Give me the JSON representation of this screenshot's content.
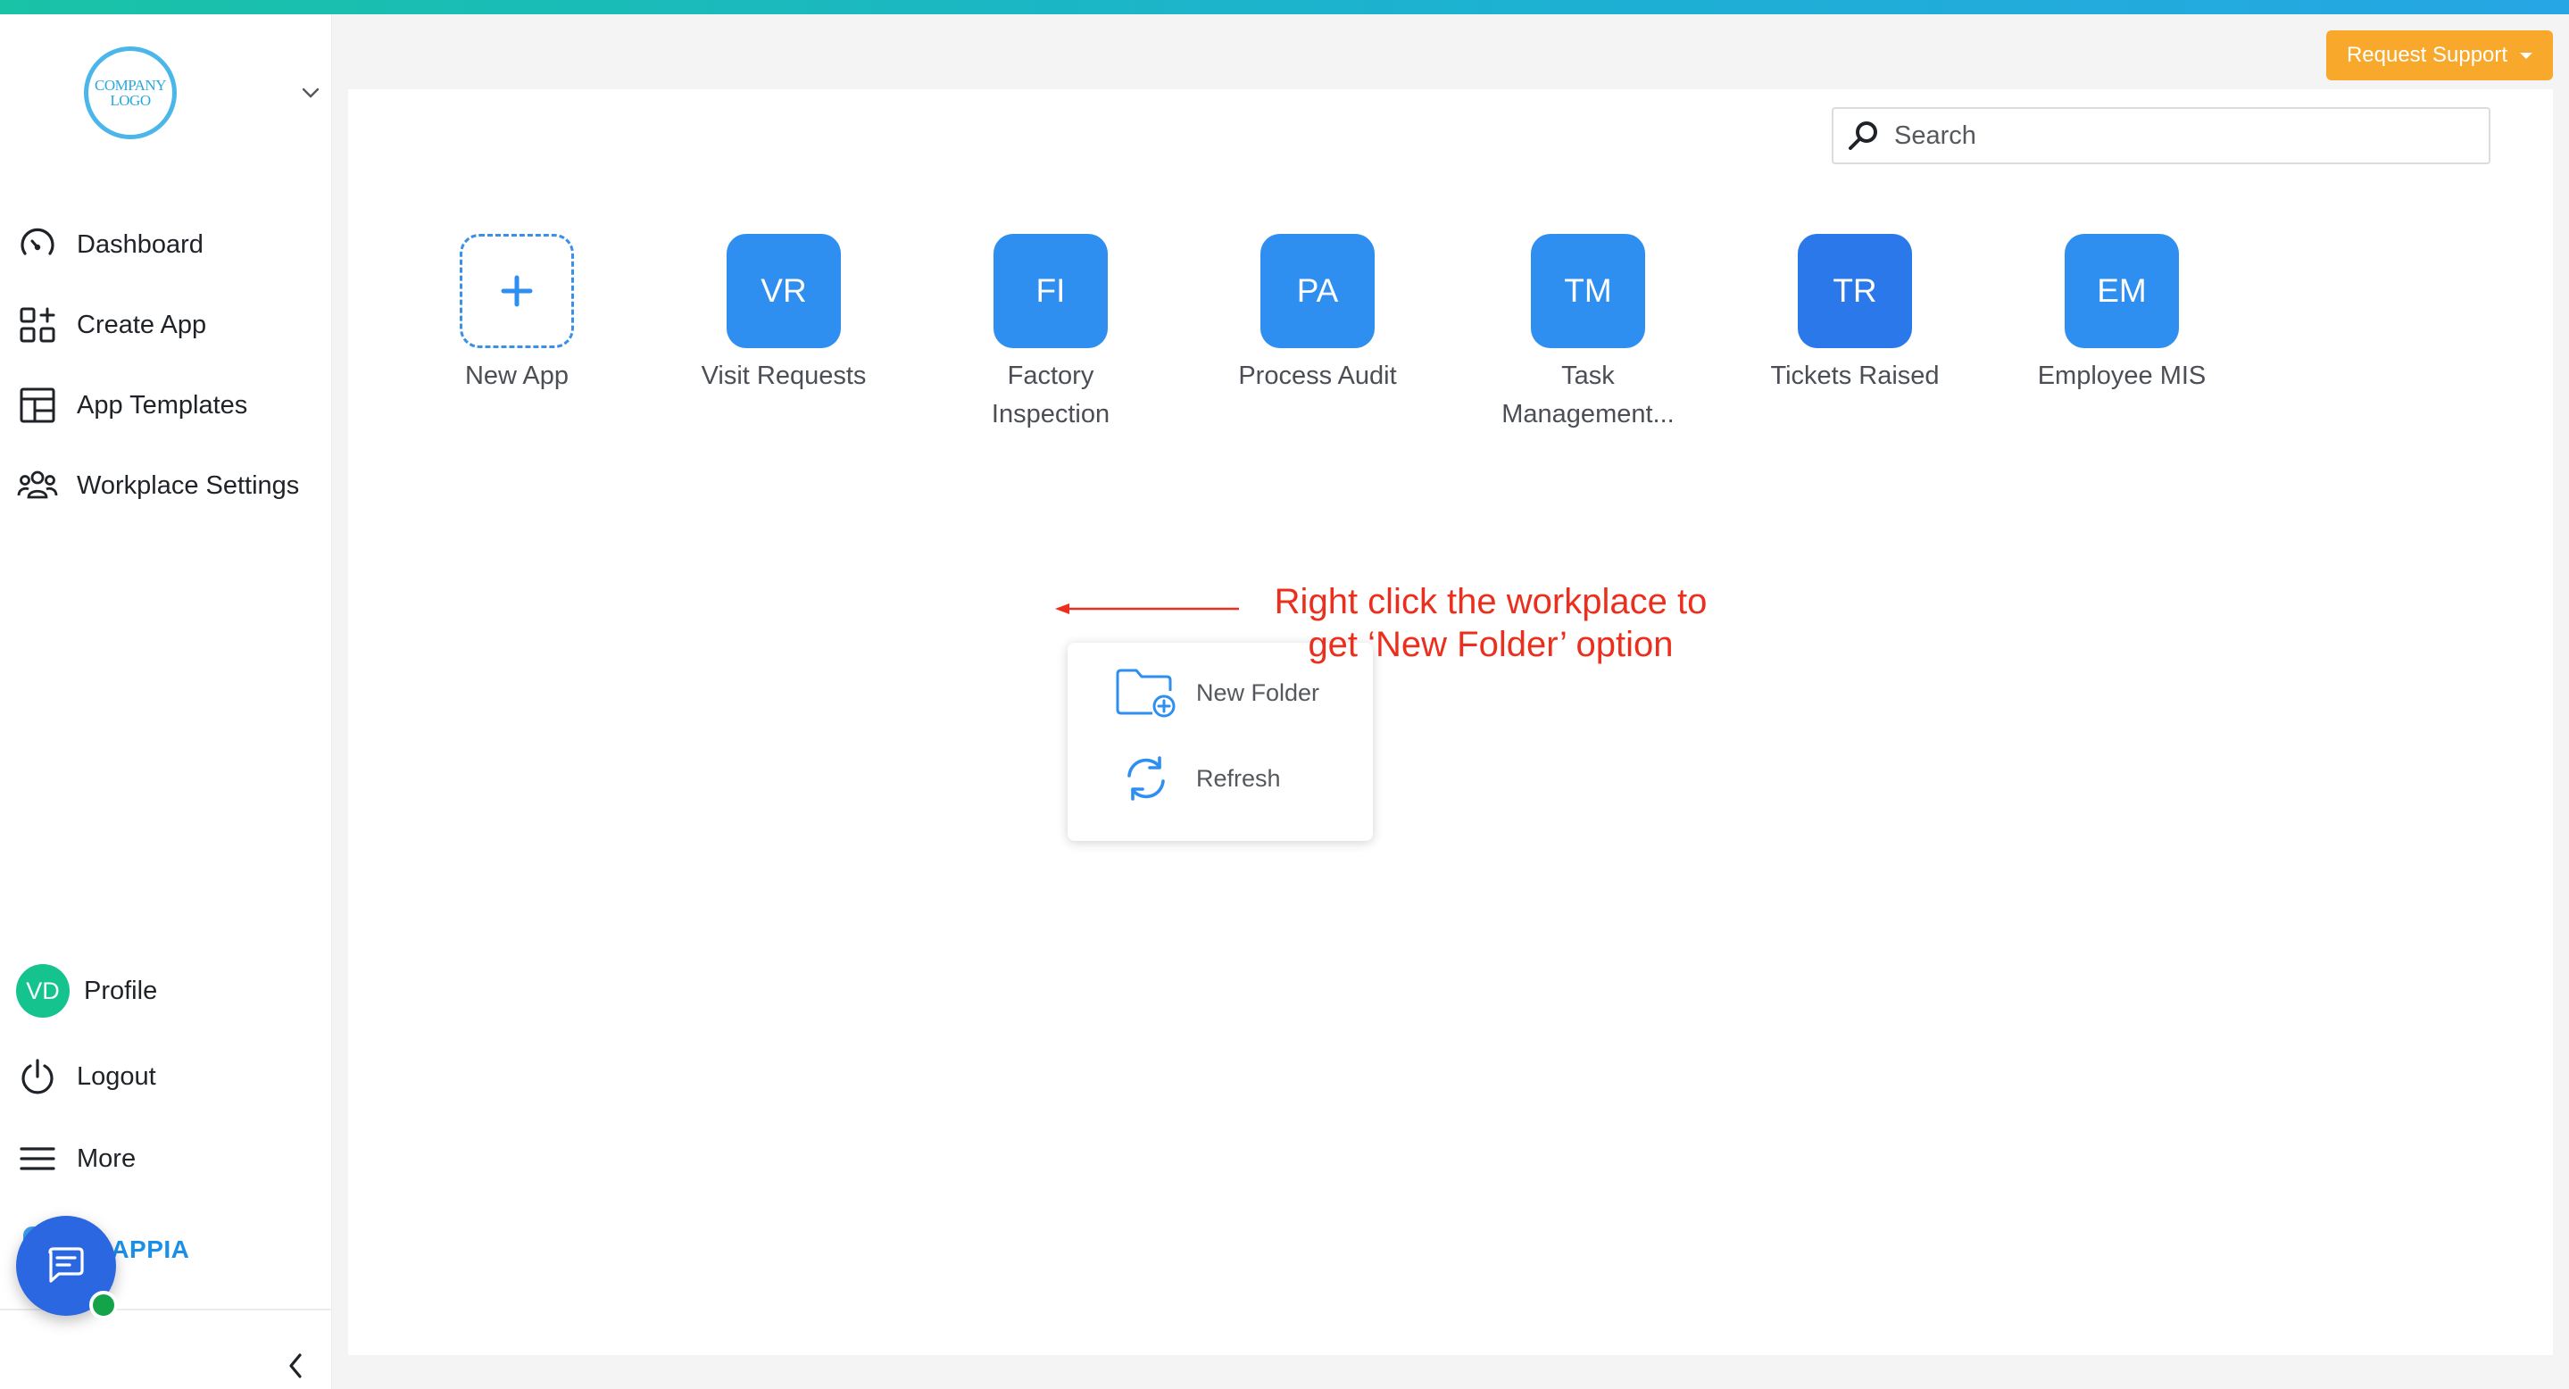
{
  "branding": {
    "logo_line1": "COMPANY",
    "logo_line2": "LOGO",
    "product_name": "CLAPPIA"
  },
  "sidebar": {
    "items": [
      {
        "label": "Dashboard",
        "icon": "dashboard-gauge-icon"
      },
      {
        "label": "Create App",
        "icon": "create-app-icon"
      },
      {
        "label": "App Templates",
        "icon": "app-templates-icon"
      },
      {
        "label": "Workplace Settings",
        "icon": "people-settings-icon"
      }
    ],
    "profile": {
      "initials": "VD",
      "label": "Profile"
    },
    "logout_label": "Logout",
    "more_label": "More"
  },
  "header": {
    "request_support_label": "Request Support"
  },
  "search": {
    "placeholder": "Search",
    "value": ""
  },
  "apps": [
    {
      "initials": "+",
      "name": "New App",
      "type": "new"
    },
    {
      "initials": "VR",
      "name": "Visit Requests"
    },
    {
      "initials": "FI",
      "name": "Factory Inspection"
    },
    {
      "initials": "PA",
      "name": "Process Audit"
    },
    {
      "initials": "TM",
      "name": "Task Management..."
    },
    {
      "initials": "TR",
      "name": "Tickets Raised"
    },
    {
      "initials": "EM",
      "name": "Employee MIS"
    }
  ],
  "context_menu": {
    "items": [
      {
        "label": "New Folder",
        "icon": "folder-plus-icon"
      },
      {
        "label": "Refresh",
        "icon": "refresh-icon"
      }
    ]
  },
  "annotation": {
    "line1": "Right click the workplace to",
    "line2": "get ‘New Folder’ option"
  },
  "colors": {
    "accent": "#2f8ff0",
    "support_button": "#f8a92c",
    "annotation": "#ec2f1d",
    "profile_avatar": "#14c38e",
    "chat_button": "#2b67e0"
  }
}
